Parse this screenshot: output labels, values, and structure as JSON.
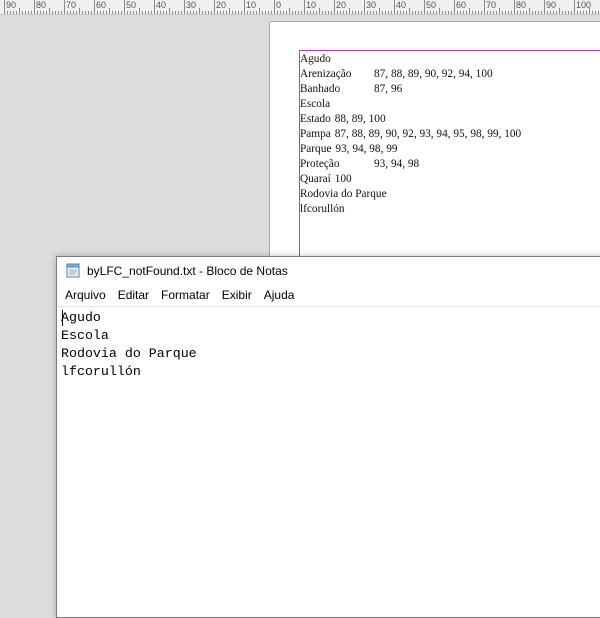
{
  "ruler": {
    "labels": [
      "90",
      "80",
      "70",
      "60",
      "50",
      "40",
      "30",
      "20",
      "10",
      "0",
      "10",
      "20",
      "30",
      "40",
      "50",
      "60",
      "70",
      "80",
      "90",
      "100"
    ]
  },
  "index": {
    "lines": [
      {
        "term": "Agudo",
        "pages": ""
      },
      {
        "term": "Arenização",
        "pages": "87, 88, 89, 90, 92, 94, 100"
      },
      {
        "term": "Banhado",
        "pages": "87, 96"
      },
      {
        "term": "Escola",
        "pages": ""
      },
      {
        "term": "Estado",
        "pages": "88, 89, 100"
      },
      {
        "term": "Pampa",
        "pages": "87, 88, 89, 90, 92, 93, 94, 95, 98, 99, 100"
      },
      {
        "term": "Parque",
        "pages": "93, 94, 98, 99"
      },
      {
        "term": "Proteção",
        "pages": "93, 94, 98"
      },
      {
        "term": "Quaraí",
        "pages": "100"
      },
      {
        "term": "Rodovia do Parque",
        "pages": ""
      },
      {
        "term": "lfcorullón",
        "pages": ""
      }
    ]
  },
  "notepad": {
    "title": "byLFC_notFound.txt - Bloco de Notas",
    "menu": [
      "Arquivo",
      "Editar",
      "Formatar",
      "Exibir",
      "Ajuda"
    ],
    "lines": [
      "Agudo",
      "Escola",
      "Rodovia do Parque",
      "lfcorullón"
    ]
  },
  "colors": {
    "frame": "#c33bc3",
    "background": "#dcdcdc"
  }
}
